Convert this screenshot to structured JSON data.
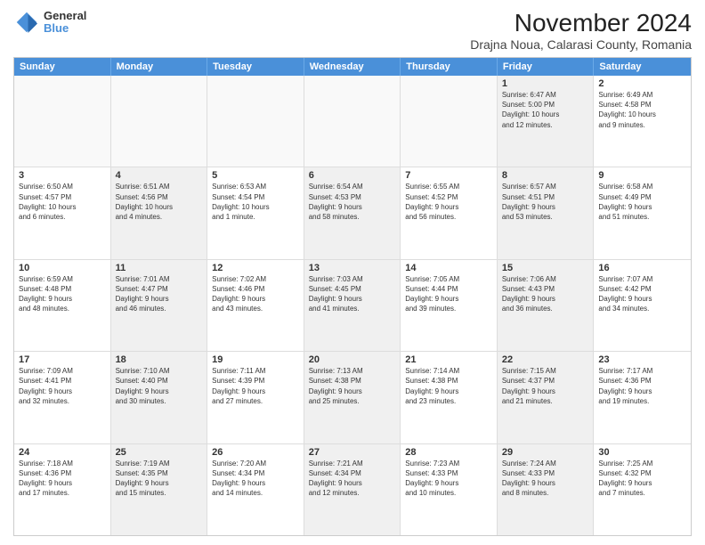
{
  "header": {
    "title": "November 2024",
    "subtitle": "Drajna Noua, Calarasi County, Romania",
    "logo_general": "General",
    "logo_blue": "Blue"
  },
  "days_of_week": [
    "Sunday",
    "Monday",
    "Tuesday",
    "Wednesday",
    "Thursday",
    "Friday",
    "Saturday"
  ],
  "rows": [
    {
      "cells": [
        {
          "empty": true
        },
        {
          "empty": true
        },
        {
          "empty": true
        },
        {
          "empty": true
        },
        {
          "empty": true
        },
        {
          "day": "1",
          "shaded": true,
          "info": "Sunrise: 6:47 AM\nSunset: 5:00 PM\nDaylight: 10 hours\nand 12 minutes."
        },
        {
          "day": "2",
          "shaded": false,
          "info": "Sunrise: 6:49 AM\nSunset: 4:58 PM\nDaylight: 10 hours\nand 9 minutes."
        }
      ]
    },
    {
      "cells": [
        {
          "day": "3",
          "shaded": false,
          "info": "Sunrise: 6:50 AM\nSunset: 4:57 PM\nDaylight: 10 hours\nand 6 minutes."
        },
        {
          "day": "4",
          "shaded": true,
          "info": "Sunrise: 6:51 AM\nSunset: 4:56 PM\nDaylight: 10 hours\nand 4 minutes."
        },
        {
          "day": "5",
          "shaded": false,
          "info": "Sunrise: 6:53 AM\nSunset: 4:54 PM\nDaylight: 10 hours\nand 1 minute."
        },
        {
          "day": "6",
          "shaded": true,
          "info": "Sunrise: 6:54 AM\nSunset: 4:53 PM\nDaylight: 9 hours\nand 58 minutes."
        },
        {
          "day": "7",
          "shaded": false,
          "info": "Sunrise: 6:55 AM\nSunset: 4:52 PM\nDaylight: 9 hours\nand 56 minutes."
        },
        {
          "day": "8",
          "shaded": true,
          "info": "Sunrise: 6:57 AM\nSunset: 4:51 PM\nDaylight: 9 hours\nand 53 minutes."
        },
        {
          "day": "9",
          "shaded": false,
          "info": "Sunrise: 6:58 AM\nSunset: 4:49 PM\nDaylight: 9 hours\nand 51 minutes."
        }
      ]
    },
    {
      "cells": [
        {
          "day": "10",
          "shaded": false,
          "info": "Sunrise: 6:59 AM\nSunset: 4:48 PM\nDaylight: 9 hours\nand 48 minutes."
        },
        {
          "day": "11",
          "shaded": true,
          "info": "Sunrise: 7:01 AM\nSunset: 4:47 PM\nDaylight: 9 hours\nand 46 minutes."
        },
        {
          "day": "12",
          "shaded": false,
          "info": "Sunrise: 7:02 AM\nSunset: 4:46 PM\nDaylight: 9 hours\nand 43 minutes."
        },
        {
          "day": "13",
          "shaded": true,
          "info": "Sunrise: 7:03 AM\nSunset: 4:45 PM\nDaylight: 9 hours\nand 41 minutes."
        },
        {
          "day": "14",
          "shaded": false,
          "info": "Sunrise: 7:05 AM\nSunset: 4:44 PM\nDaylight: 9 hours\nand 39 minutes."
        },
        {
          "day": "15",
          "shaded": true,
          "info": "Sunrise: 7:06 AM\nSunset: 4:43 PM\nDaylight: 9 hours\nand 36 minutes."
        },
        {
          "day": "16",
          "shaded": false,
          "info": "Sunrise: 7:07 AM\nSunset: 4:42 PM\nDaylight: 9 hours\nand 34 minutes."
        }
      ]
    },
    {
      "cells": [
        {
          "day": "17",
          "shaded": false,
          "info": "Sunrise: 7:09 AM\nSunset: 4:41 PM\nDaylight: 9 hours\nand 32 minutes."
        },
        {
          "day": "18",
          "shaded": true,
          "info": "Sunrise: 7:10 AM\nSunset: 4:40 PM\nDaylight: 9 hours\nand 30 minutes."
        },
        {
          "day": "19",
          "shaded": false,
          "info": "Sunrise: 7:11 AM\nSunset: 4:39 PM\nDaylight: 9 hours\nand 27 minutes."
        },
        {
          "day": "20",
          "shaded": true,
          "info": "Sunrise: 7:13 AM\nSunset: 4:38 PM\nDaylight: 9 hours\nand 25 minutes."
        },
        {
          "day": "21",
          "shaded": false,
          "info": "Sunrise: 7:14 AM\nSunset: 4:38 PM\nDaylight: 9 hours\nand 23 minutes."
        },
        {
          "day": "22",
          "shaded": true,
          "info": "Sunrise: 7:15 AM\nSunset: 4:37 PM\nDaylight: 9 hours\nand 21 minutes."
        },
        {
          "day": "23",
          "shaded": false,
          "info": "Sunrise: 7:17 AM\nSunset: 4:36 PM\nDaylight: 9 hours\nand 19 minutes."
        }
      ]
    },
    {
      "cells": [
        {
          "day": "24",
          "shaded": false,
          "info": "Sunrise: 7:18 AM\nSunset: 4:36 PM\nDaylight: 9 hours\nand 17 minutes."
        },
        {
          "day": "25",
          "shaded": true,
          "info": "Sunrise: 7:19 AM\nSunset: 4:35 PM\nDaylight: 9 hours\nand 15 minutes."
        },
        {
          "day": "26",
          "shaded": false,
          "info": "Sunrise: 7:20 AM\nSunset: 4:34 PM\nDaylight: 9 hours\nand 14 minutes."
        },
        {
          "day": "27",
          "shaded": true,
          "info": "Sunrise: 7:21 AM\nSunset: 4:34 PM\nDaylight: 9 hours\nand 12 minutes."
        },
        {
          "day": "28",
          "shaded": false,
          "info": "Sunrise: 7:23 AM\nSunset: 4:33 PM\nDaylight: 9 hours\nand 10 minutes."
        },
        {
          "day": "29",
          "shaded": true,
          "info": "Sunrise: 7:24 AM\nSunset: 4:33 PM\nDaylight: 9 hours\nand 8 minutes."
        },
        {
          "day": "30",
          "shaded": false,
          "info": "Sunrise: 7:25 AM\nSunset: 4:32 PM\nDaylight: 9 hours\nand 7 minutes."
        }
      ]
    }
  ]
}
